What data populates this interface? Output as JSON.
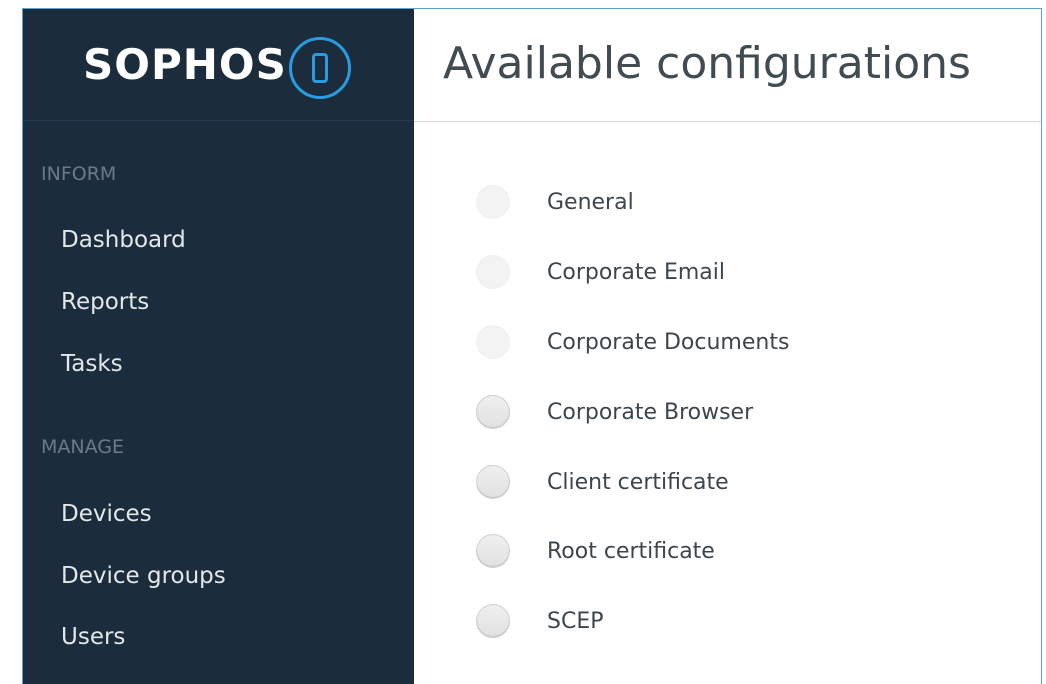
{
  "brand": {
    "name": "SOPHOS",
    "icon": "mobile-phone-icon",
    "accent_color": "#2a9be0"
  },
  "sidebar": {
    "background_color": "#1b2d3d",
    "sections": [
      {
        "label": "INFORM",
        "items": [
          {
            "label": "Dashboard"
          },
          {
            "label": "Reports"
          },
          {
            "label": "Tasks"
          }
        ]
      },
      {
        "label": "MANAGE",
        "items": [
          {
            "label": "Devices"
          },
          {
            "label": "Device groups"
          },
          {
            "label": "Users"
          }
        ]
      }
    ]
  },
  "main": {
    "title": "Available configurations",
    "configurations": [
      {
        "label": "General",
        "radio_style": "faint",
        "selected": false
      },
      {
        "label": "Corporate Email",
        "radio_style": "faint",
        "selected": false
      },
      {
        "label": "Corporate Documents",
        "radio_style": "faint",
        "selected": false
      },
      {
        "label": "Corporate Browser",
        "radio_style": "normal",
        "selected": false
      },
      {
        "label": "Client certificate",
        "radio_style": "normal",
        "selected": false
      },
      {
        "label": "Root certificate",
        "radio_style": "normal",
        "selected": false
      },
      {
        "label": "SCEP",
        "radio_style": "normal",
        "selected": false
      }
    ]
  }
}
